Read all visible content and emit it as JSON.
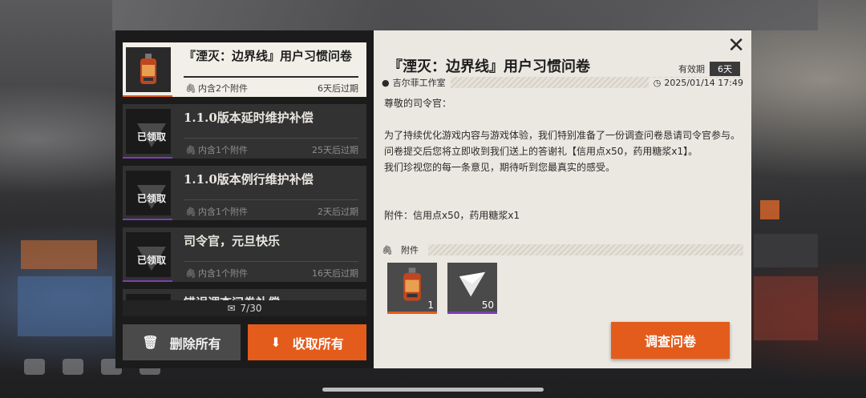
{
  "mail_list": {
    "items": [
      {
        "title": "『湮灭：边界线』用户习惯问卷",
        "attachments": "内含2个附件",
        "expire": "6天后过期",
        "claimed": false
      },
      {
        "title": "1.1.0版本延时维护补偿",
        "attachments": "内含1个附件",
        "expire": "25天后过期",
        "claimed": true
      },
      {
        "title": "1.1.0版本例行维护补偿",
        "attachments": "内含1个附件",
        "expire": "2天后过期",
        "claimed": true
      },
      {
        "title": "司令官，元旦快乐",
        "attachments": "内含1个附件",
        "expire": "16天后过期",
        "claimed": true
      },
      {
        "title": "错误调查问卷补偿",
        "attachments": "",
        "expire": "",
        "claimed": false
      }
    ],
    "claimed_label": "已领取",
    "count": "7/30"
  },
  "buttons": {
    "delete_all": "删除所有",
    "claim_all": "收取所有",
    "survey": "调查问卷"
  },
  "detail": {
    "title": "『湮灭：边界线』用户习惯问卷",
    "validity_label": "有效期",
    "validity_value": "6天",
    "sender": "吉尔菲工作室",
    "date": "2025/01/14 17:49",
    "body": [
      "尊敬的司令官：",
      "",
      "为了持续优化游戏内容与游戏体验，我们特别准备了一份调查问卷恳请司令官参与。问卷提交后您将立即收到我们送上的答谢礼【信用点x50，药用糖浆x1】。",
      "我们珍视您的每一条意见，期待听到您最真实的感受。",
      "",
      "",
      "附件：信用点x50，药用糖浆x1"
    ],
    "attachments_label": "附件",
    "attachments": [
      {
        "icon": "syrup-bottle-icon",
        "count": "1",
        "rarity_color": "#e35c1c"
      },
      {
        "icon": "credit-chip-icon",
        "count": "50",
        "rarity_color": "#7a3fb0"
      }
    ]
  },
  "colors": {
    "accent": "#e35c1c",
    "purple": "#7a3fb0",
    "panel": "#ebe8e1"
  }
}
